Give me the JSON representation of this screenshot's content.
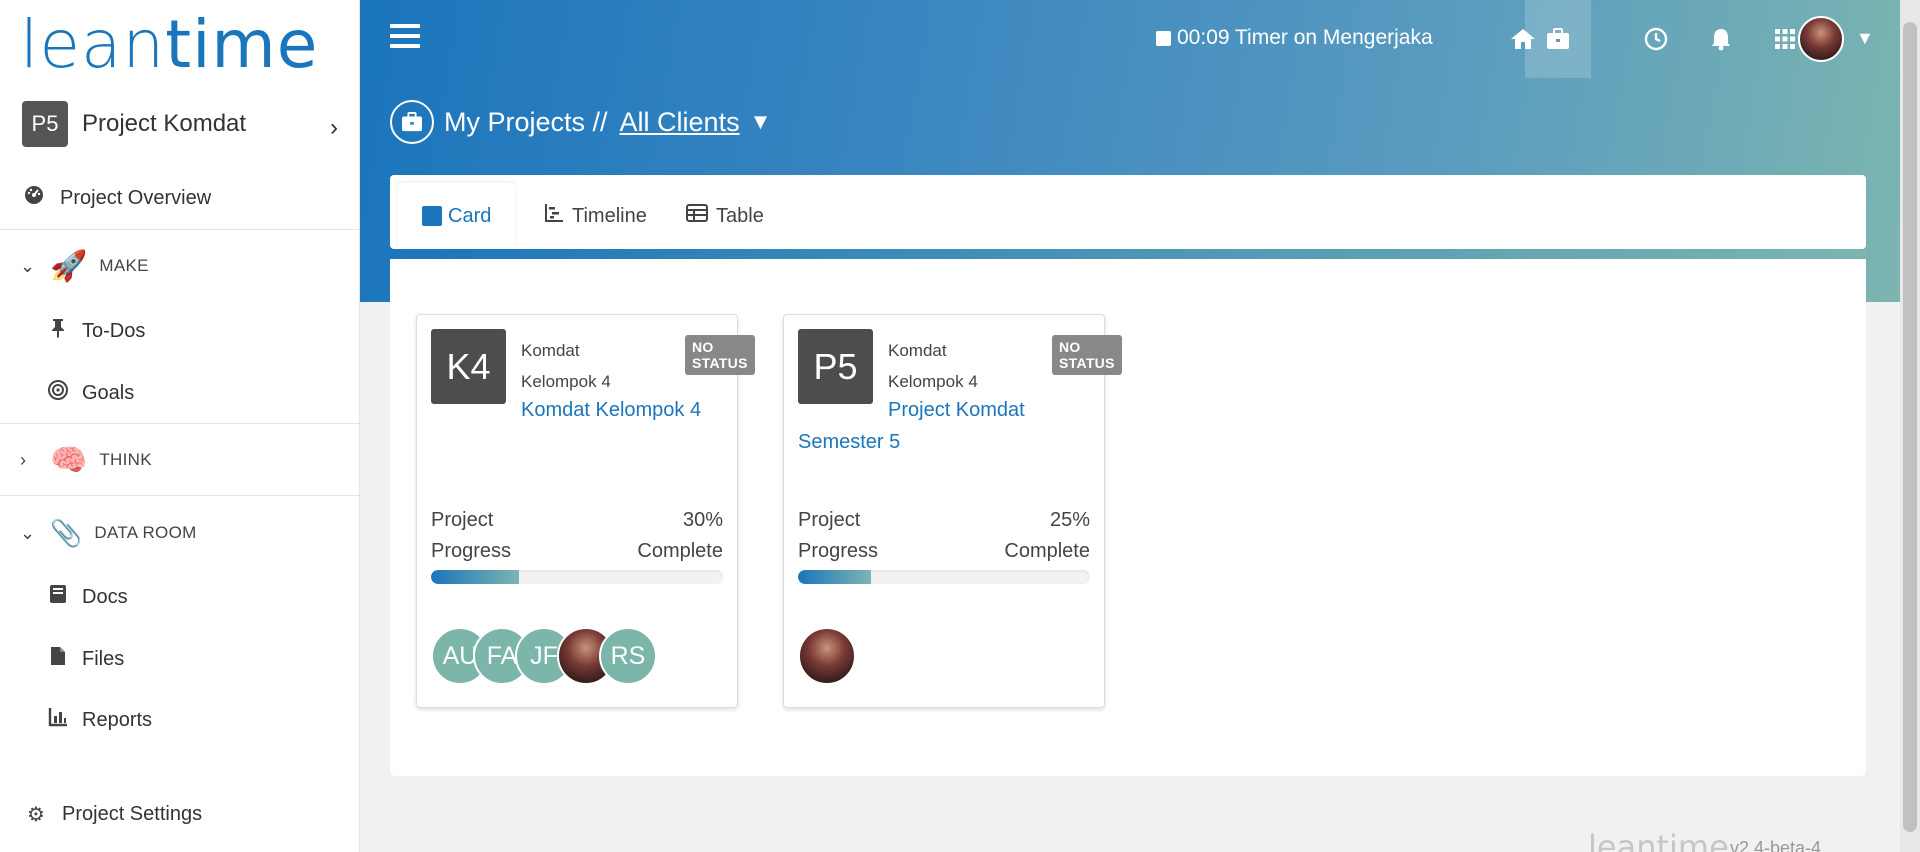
{
  "app": {
    "logo_lean": "lean",
    "logo_time": "time"
  },
  "sidebar": {
    "project": {
      "avatar": "P5",
      "name": "Project Komdat"
    },
    "overview": {
      "label": "Project Overview",
      "icon": "dashboard-icon"
    },
    "sections": [
      {
        "label": "MAKE",
        "icon": "rocket-icon",
        "expanded": true,
        "items": [
          {
            "label": "To-Dos",
            "icon": "pin-icon"
          },
          {
            "label": "Goals",
            "icon": "target-icon"
          }
        ]
      },
      {
        "label": "THINK",
        "icon": "brain-icon",
        "expanded": false,
        "items": []
      },
      {
        "label": "DATA ROOM",
        "icon": "paperclip-icon",
        "expanded": true,
        "items": [
          {
            "label": "Docs",
            "icon": "book-icon"
          },
          {
            "label": "Files",
            "icon": "file-icon"
          },
          {
            "label": "Reports",
            "icon": "chart-icon"
          }
        ]
      }
    ],
    "settings": {
      "label": "Project Settings",
      "icon": "gear-icon"
    }
  },
  "topbar": {
    "timer": "00:09 Timer on Mengerjaka",
    "icons": [
      "home-icon",
      "briefcase-icon",
      "clock-icon",
      "bell-icon",
      "apps-grid-icon"
    ],
    "active_icon": "briefcase-icon"
  },
  "page": {
    "title": "My Projects //",
    "client_filter": "All Clients"
  },
  "tabs": [
    {
      "label": "Card",
      "icon": "card-icon",
      "active": true
    },
    {
      "label": "Timeline",
      "icon": "timeline-icon",
      "active": false
    },
    {
      "label": "Table",
      "icon": "table-icon",
      "active": false
    }
  ],
  "projects": [
    {
      "avatar": "K4",
      "client_line1": "Komdat",
      "client_line2": "Kelompok 4",
      "title": "Komdat Kelompok 4",
      "status": "NO STATUS",
      "progress_label_left": "Project Progress",
      "progress_percent": "30%",
      "progress_label_right": "Complete",
      "progress_value": 30,
      "members": [
        "AU",
        "FA",
        "JF",
        "photo",
        "RS"
      ]
    },
    {
      "avatar": "P5",
      "client_line1": "Komdat",
      "client_line2": "Kelompok 4",
      "title": "Project Komdat Semester 5",
      "status": "NO STATUS",
      "progress_label_left": "Project Progress",
      "progress_percent": "25%",
      "progress_label_right": "Complete",
      "progress_value": 25,
      "members": [
        "photo"
      ]
    }
  ],
  "footer": {
    "logo": "leantime",
    "version": "v2.4-beta-4"
  },
  "colors": {
    "accent": "#1b75bb",
    "accent_end": "#7cb5b0",
    "badge": "#888888",
    "member_bg": "#7cb5a9"
  }
}
